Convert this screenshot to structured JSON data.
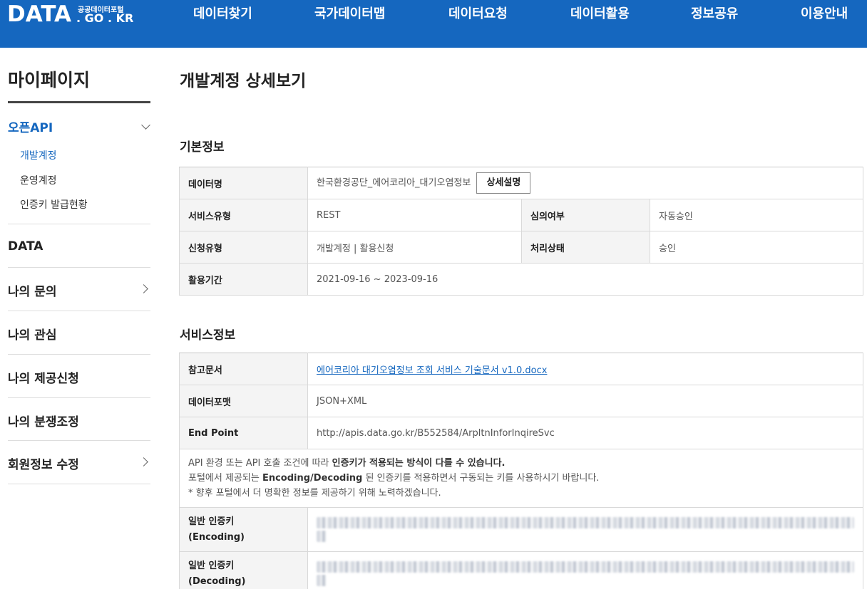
{
  "header": {
    "logo_main": "DATA",
    "logo_sub": "공공데이터포털",
    "logo_kr": ". GO . KR",
    "nav": [
      "데이터찾기",
      "국가데이터맵",
      "데이터요청",
      "데이터활용",
      "정보공유",
      "이용안내"
    ]
  },
  "sidebar": {
    "title": "마이페이지",
    "open_api": "오픈API",
    "sub_items": [
      "개발계정",
      "운영계정",
      "인증키 발급현황"
    ],
    "items": [
      "DATA",
      "나의 문의",
      "나의 관심",
      "나의 제공신청",
      "나의 분쟁조정",
      "회원정보 수정"
    ]
  },
  "page_title": "개발계정 상세보기",
  "basic": {
    "title": "기본정보",
    "data_name_label": "데이터명",
    "data_name": "한국환경공단_에어코리아_대기오염정보",
    "detail_button": "상세설명",
    "service_type_label": "서비스유형",
    "service_type": "REST",
    "review_label": "심의여부",
    "review": "자동승인",
    "apply_type_label": "신청유형",
    "apply_type": "개발계정 | 활용신청",
    "status_label": "처리상태",
    "status": "승인",
    "period_label": "활용기간",
    "period": "2021-09-16 ~ 2023-09-16"
  },
  "service": {
    "title": "서비스정보",
    "ref_doc_label": "참고문서",
    "ref_doc": "에어코리아 대기오염정보 조회 서비스 기술문서 v1.0.docx",
    "format_label": "데이터포맷",
    "format": "JSON+XML",
    "endpoint_label": "End Point",
    "endpoint": "http://apis.data.go.kr/B552584/ArpltnInforInqireSvc",
    "notice_1a": "API 환경 또는 API 호출 조건에 따라 ",
    "notice_1b": "인증키가 적용되는 방식이 다를 수 있습니다.",
    "notice_2a": "포털에서 제공되는 ",
    "notice_2b": "Encoding/Decoding",
    "notice_2c": " 된 인증키를 적용하면서 구동되는 키를 사용하시기 바랍니다.",
    "notice_3": "* 향후 포털에서 더 명확한 정보를 제공하기 위해 노력하겠습니다.",
    "enc_label_1": "일반 인증키",
    "enc_label_2": "(Encoding)",
    "dec_label_1": "일반 인증키",
    "dec_label_2": "(Decoding)"
  },
  "colors": {
    "brand": "#1567bf",
    "header_bg": "#1567bf",
    "th_bg": "#f4f4f4"
  }
}
